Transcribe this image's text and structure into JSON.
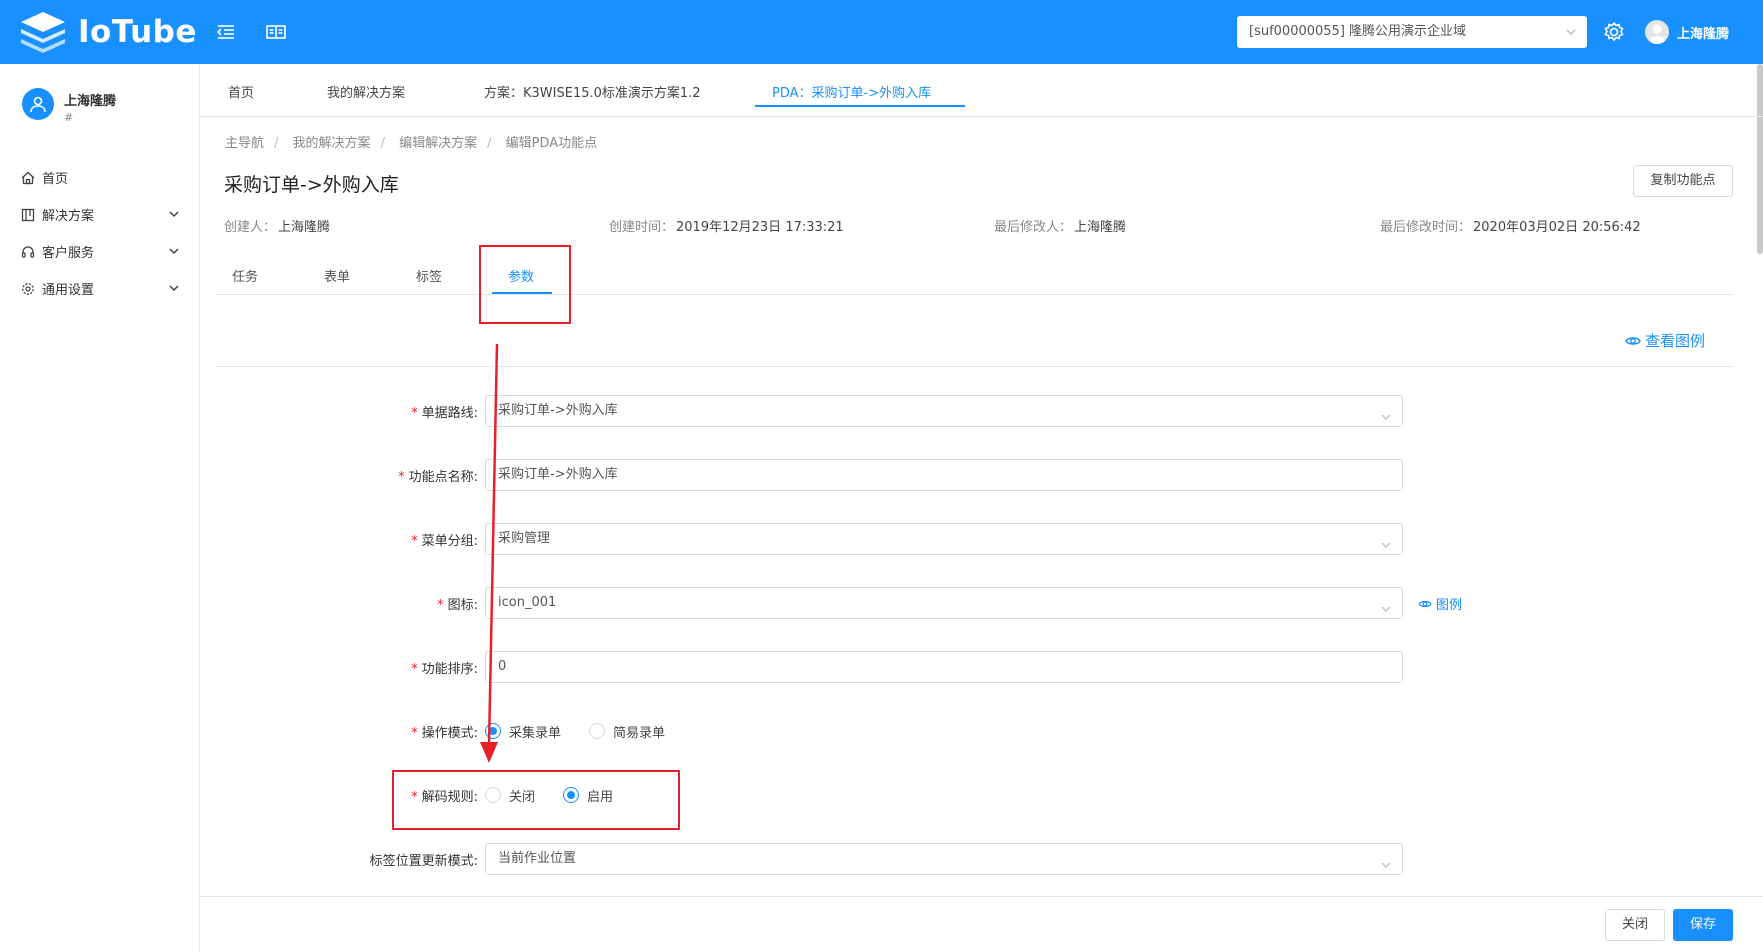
{
  "header": {
    "brand": "IoTube",
    "domain_select": "[suf00000055] 隆腾公用演示企业域",
    "username": "上海隆腾"
  },
  "sidebar": {
    "user_name": "上海隆腾",
    "user_sub": "#",
    "items": [
      {
        "label": "首页",
        "icon": "home-icon"
      },
      {
        "label": "解决方案",
        "icon": "solution-icon"
      },
      {
        "label": "客户服务",
        "icon": "headset-icon"
      },
      {
        "label": "通用设置",
        "icon": "gear-icon"
      }
    ]
  },
  "top_tabs": [
    {
      "label": "首页"
    },
    {
      "label": "我的解决方案"
    },
    {
      "label": "方案：K3WISE15.0标准演示方案1.2"
    },
    {
      "label": "PDA：采购订单->外购入库"
    }
  ],
  "breadcrumb": [
    "主导航",
    "我的解决方案",
    "编辑解决方案",
    "编辑PDA功能点"
  ],
  "page": {
    "title": "采购订单->外购入库",
    "copy_button": "复制功能点",
    "creator_label": "创建人：",
    "creator": "上海隆腾",
    "created_label": "创建时间：",
    "created": "2019年12月23日 17:33:21",
    "modifier_label": "最后修改人：",
    "modifier": "上海隆腾",
    "modified_label": "最后修改时间：",
    "modified": "2020年03月02日 20:56:42"
  },
  "inner_tabs": [
    {
      "label": "任务"
    },
    {
      "label": "表单"
    },
    {
      "label": "标签"
    },
    {
      "label": "参数"
    }
  ],
  "view_example": "查看图例",
  "form": {
    "route_label": "单据路线:",
    "route_value": "采购订单->外购入库",
    "name_label": "功能点名称:",
    "name_value": "采购订单->外购入库",
    "group_label": "菜单分组:",
    "group_value": "采购管理",
    "icon_label": "图标:",
    "icon_value": "icon_001",
    "icon_example": "图例",
    "sort_label": "功能排序:",
    "sort_value": "0",
    "mode_label": "操作模式:",
    "mode_options": [
      "采集录单",
      "简易录单"
    ],
    "decode_label": "解码规则:",
    "decode_options": [
      "关闭",
      "启用"
    ],
    "tag_label": "标签位置更新模式:",
    "tag_value": "当前作业位置"
  },
  "footer": {
    "close": "关闭",
    "save": "保存"
  },
  "colors": {
    "primary": "#1890ff",
    "annotation_red": "#e8202a"
  }
}
